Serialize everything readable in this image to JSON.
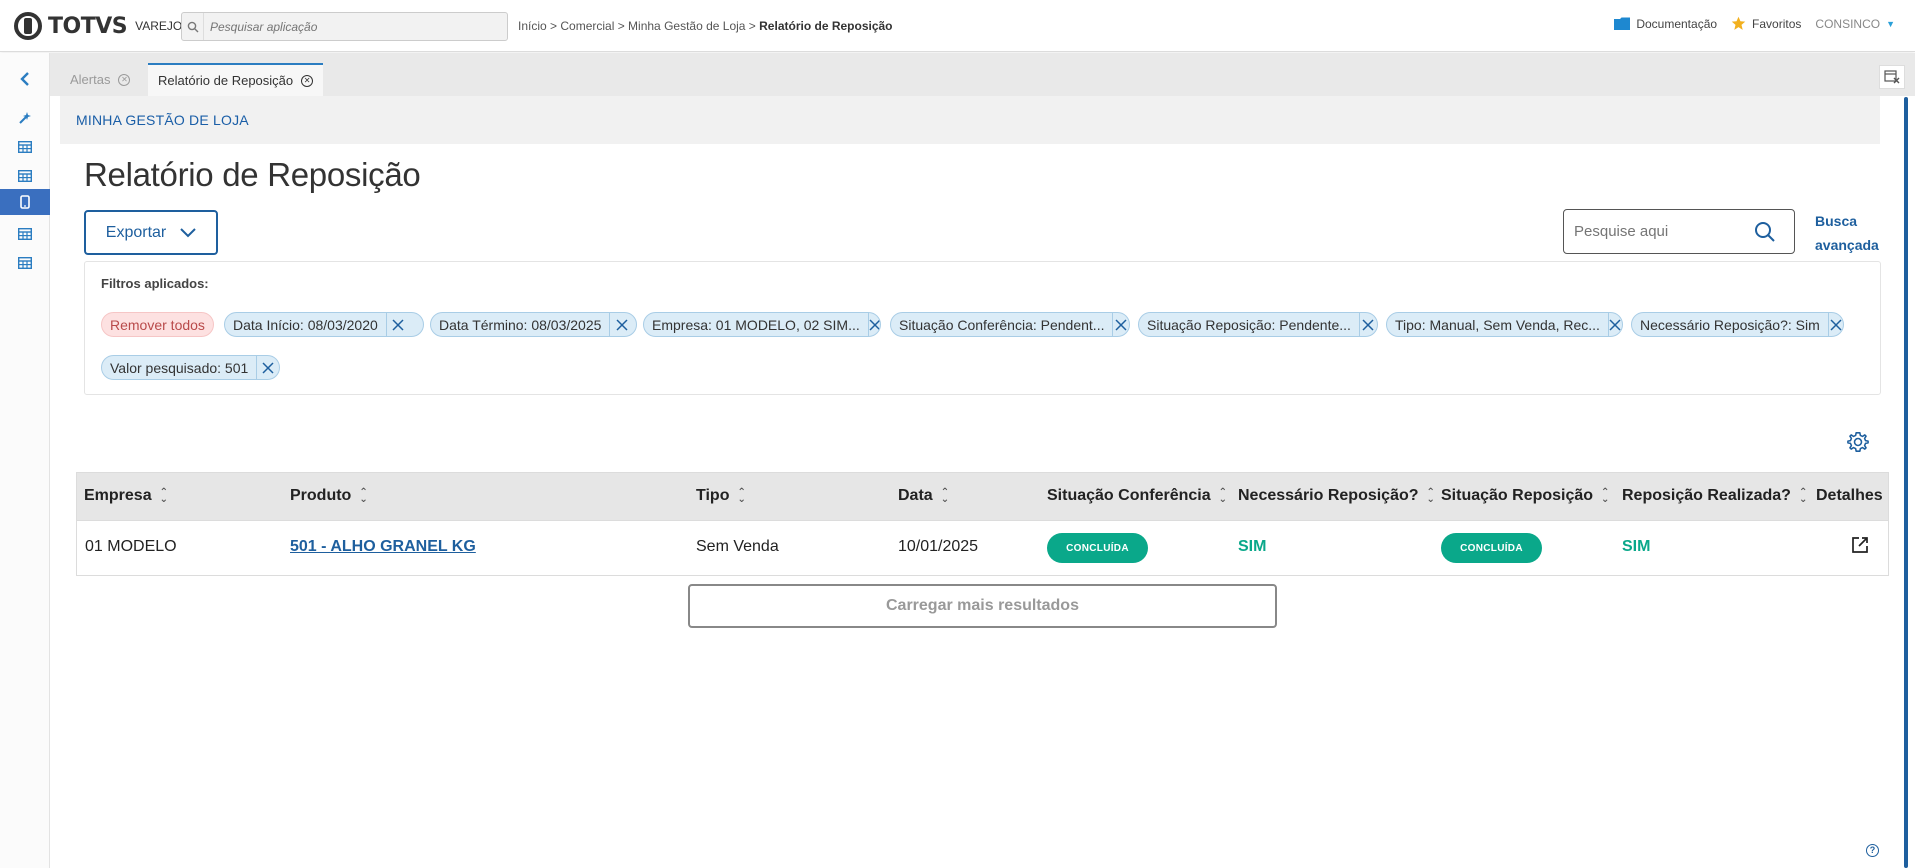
{
  "header": {
    "logo_text": "TOTVS",
    "logo_sub": "VAREJO",
    "search_placeholder": "Pesquisar aplicação",
    "breadcrumb": {
      "path": "Início > Comercial > Minha Gestão de Loja > ",
      "current": "Relatório de Reposição"
    },
    "documentation": "Documentação",
    "favorites": "Favoritos",
    "user": "CONSINCO"
  },
  "tabs": [
    {
      "label": "Alertas"
    },
    {
      "label": "Relatório de Reposição"
    }
  ],
  "section": {
    "title": "MINHA GESTÃO DE LOJA"
  },
  "page": {
    "title": "Relatório de Reposição",
    "export_label": "Exportar",
    "search_placeholder": "Pesquise aqui",
    "advanced_search_line1": "Busca",
    "advanced_search_line2": "avançada"
  },
  "filters": {
    "title": "Filtros aplicados:",
    "remove_all": "Remover todos",
    "chips": [
      "Data Início: 08/03/2020",
      "Data Término: 08/03/2025",
      "Empresa: 01 MODELO, 02 SIM...",
      "Situação Conferência: Pendent...",
      "Situação Reposição: Pendente...",
      "Tipo: Manual, Sem Venda, Rec...",
      "Necessário Reposição?: Sim",
      "Valor pesquisado: 501"
    ]
  },
  "table": {
    "columns": [
      "Empresa",
      "Produto",
      "Tipo",
      "Data",
      "Situação Conferência",
      "Necessário Reposição?",
      "Situação Reposição",
      "Reposição Realizada?",
      "Detalhes"
    ],
    "rows": [
      {
        "empresa": "01 MODELO",
        "produto": "501 - ALHO GRANEL KG",
        "tipo": "Sem Venda",
        "data": "10/01/2025",
        "situacao_conferencia": "CONCLUÍDA",
        "necessario_reposicao": "SIM",
        "situacao_reposicao": "CONCLUÍDA",
        "reposicao_realizada": "SIM"
      }
    ]
  },
  "load_more": "Carregar mais resultados",
  "help_icon_text": "?",
  "colors": {
    "primary": "#1e5f9e",
    "success": "#0aa88a",
    "chip_bg": "#dbecf7",
    "remove_chip_bg": "#fde1e1"
  }
}
